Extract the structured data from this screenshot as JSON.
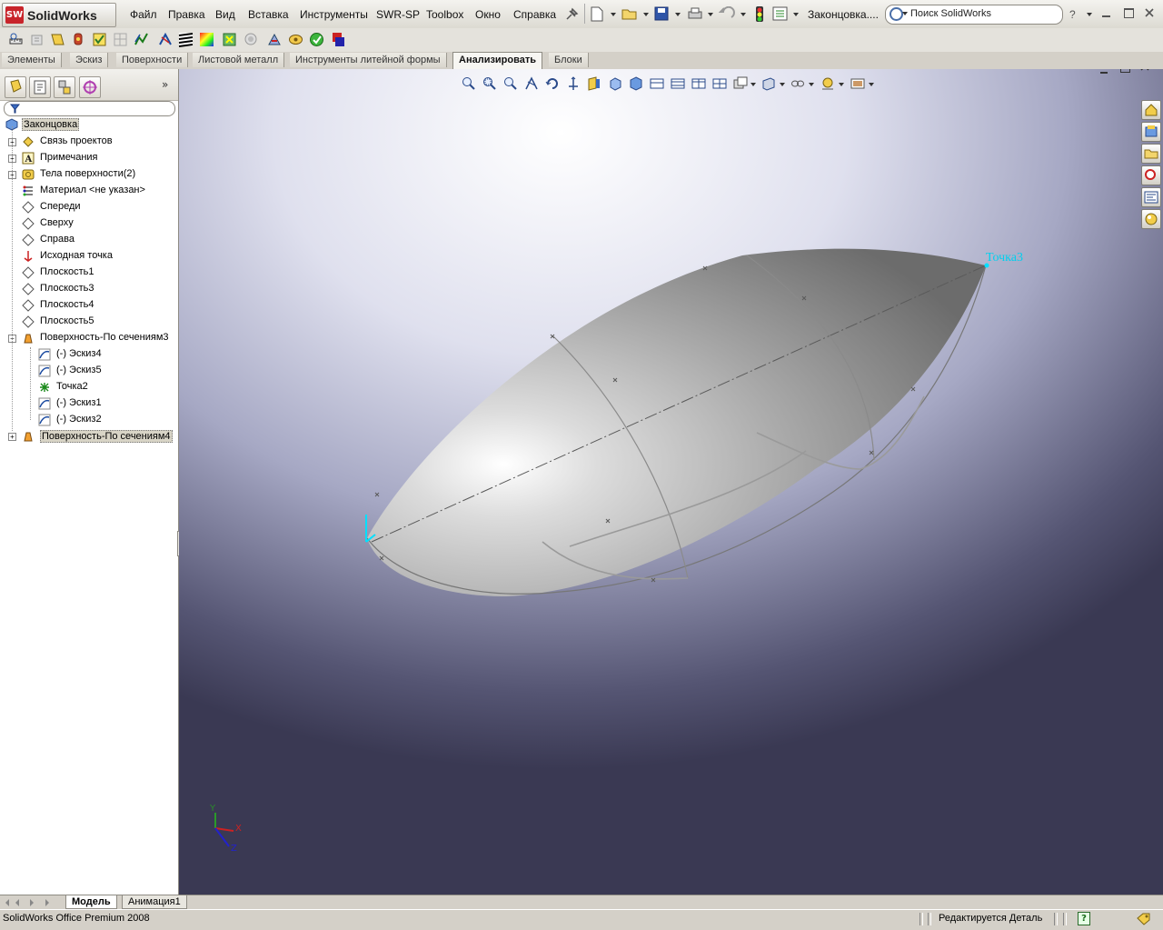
{
  "app": {
    "name": "SolidWorks",
    "logo_badge": "SW"
  },
  "menu": [
    "Файл",
    "Правка",
    "Вид",
    "Вставка",
    "Инструменты",
    "SWR-SP",
    "Toolbox",
    "Окно",
    "Справка"
  ],
  "doc_title": "Законцовка....",
  "search": {
    "placeholder": "Поиск SolidWorks"
  },
  "help_label": "?",
  "tabs": [
    "Элементы",
    "Эскиз",
    "Поверхности",
    "Листовой металл",
    "Инструменты литейной формы",
    "Анализировать",
    "Блоки"
  ],
  "active_tab": "Анализировать",
  "tree": {
    "root": "Законцовка",
    "items": [
      {
        "label": "Связь проектов",
        "expand": "+",
        "icon": "design-binder-icon",
        "indent": 0
      },
      {
        "label": "Примечания",
        "expand": "+",
        "icon": "annotations-icon",
        "indent": 0
      },
      {
        "label": "Тела поверхности(2)",
        "expand": "+",
        "icon": "surface-bodies-icon",
        "indent": 0
      },
      {
        "label": "Материал <не указан>",
        "expand": "",
        "icon": "material-icon",
        "indent": 0
      },
      {
        "label": "Спереди",
        "expand": "",
        "icon": "plane-icon",
        "indent": 0
      },
      {
        "label": "Сверху",
        "expand": "",
        "icon": "plane-icon",
        "indent": 0
      },
      {
        "label": "Справа",
        "expand": "",
        "icon": "plane-icon",
        "indent": 0
      },
      {
        "label": "Исходная точка",
        "expand": "",
        "icon": "origin-icon",
        "indent": 0
      },
      {
        "label": "Плоскость1",
        "expand": "",
        "icon": "plane-icon",
        "indent": 0
      },
      {
        "label": "Плоскость3",
        "expand": "",
        "icon": "plane-icon",
        "indent": 0
      },
      {
        "label": "Плоскость4",
        "expand": "",
        "icon": "plane-icon",
        "indent": 0
      },
      {
        "label": "Плоскость5",
        "expand": "",
        "icon": "plane-icon",
        "indent": 0
      },
      {
        "label": "Поверхность-По сечениям3",
        "expand": "−",
        "icon": "loft-surface-icon",
        "indent": 0
      },
      {
        "label": "(-) Эскиз4",
        "expand": "",
        "icon": "sketch-icon",
        "indent": 1
      },
      {
        "label": "(-) Эскиз5",
        "expand": "",
        "icon": "sketch-icon",
        "indent": 1
      },
      {
        "label": "Точка2",
        "expand": "",
        "icon": "point-icon",
        "indent": 1
      },
      {
        "label": "(-) Эскиз1",
        "expand": "",
        "icon": "sketch-icon",
        "indent": 1
      },
      {
        "label": "(-) Эскиз2",
        "expand": "",
        "icon": "sketch-icon",
        "indent": 1
      },
      {
        "label": "Поверхность-По сечениям4",
        "expand": "+",
        "icon": "loft-surface-icon",
        "indent": 0,
        "selected": true
      }
    ]
  },
  "viewport": {
    "point_label": "Точка3",
    "triad": {
      "x": "X",
      "y": "Y",
      "z": "Z"
    }
  },
  "bottom_tabs": [
    "Модель",
    "Анимация1"
  ],
  "active_bottom_tab": "Модель",
  "status": {
    "left": "SolidWorks Office Premium 2008",
    "right": "Редактируется Деталь",
    "help": "?"
  },
  "colors": {
    "accent_cyan": "#00e0ff",
    "logo_red": "#c8242a"
  }
}
